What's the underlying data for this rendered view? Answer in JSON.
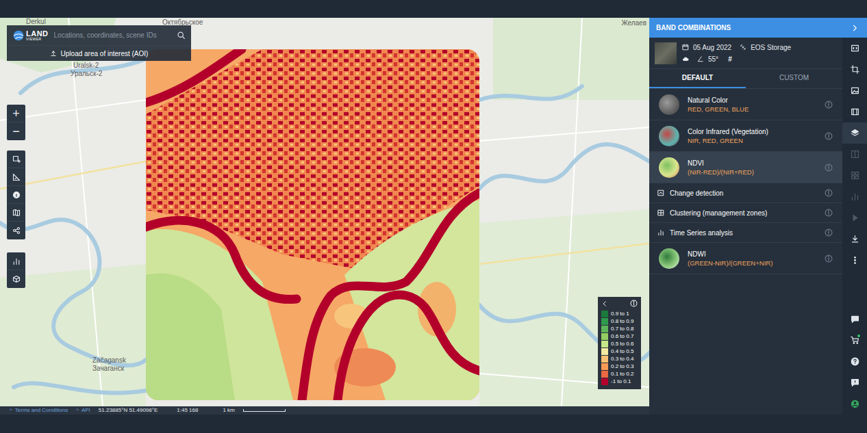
{
  "app": {
    "logo_main": "LAND",
    "logo_sub": "VIEWER"
  },
  "search": {
    "placeholder": "Locations, coordinates, scene IDs"
  },
  "upload_button": {
    "label": "Upload area of interest (AOI)"
  },
  "map_labels": {
    "derkul": "Derkul",
    "oktyabrskoe": "Октябрьское",
    "zhelaev": "Желаев",
    "uralsk_lat": "Uralsk-2",
    "uralsk_cyr": "Уральск-2",
    "zachagansk_lat": "Začagansk",
    "zachagansk_cyr": "Зачаганск"
  },
  "zoom": {
    "in": "+",
    "out": "−"
  },
  "legend": {
    "items": [
      {
        "label": "0.9 to 1",
        "color": "#1b7a3b"
      },
      {
        "label": "0.8 to 0.9",
        "color": "#2f9a4d"
      },
      {
        "label": "0.7 to 0.8",
        "color": "#5db55b"
      },
      {
        "label": "0.6 to 0.7",
        "color": "#93cf63"
      },
      {
        "label": "0.5 to 0.6",
        "color": "#c6e68a"
      },
      {
        "label": "0.4 to 0.5",
        "color": "#f5eaa2"
      },
      {
        "label": "0.3 to 0.4",
        "color": "#fcc072"
      },
      {
        "label": "0.2 to 0.3",
        "color": "#f89a56"
      },
      {
        "label": "0.1 to 0.2",
        "color": "#ea6842"
      },
      {
        "label": "-1 to 0.1",
        "color": "#b3002b"
      }
    ]
  },
  "status_bar": {
    "caret": "^",
    "terms": "Terms and Conditions",
    "api": "API",
    "coordinates": "51.23885°N 51.49098°E",
    "scale_ratio": "1:45 168",
    "scale_label": "1 km"
  },
  "panel": {
    "title": "BAND COMBINATIONS",
    "scene": {
      "date": "05 Aug 2022",
      "storage": "EOS Storage",
      "angle": "55°",
      "grid": "#"
    },
    "tabs": [
      {
        "label": "DEFAULT",
        "selected": true
      },
      {
        "label": "CUSTOM",
        "selected": false
      }
    ],
    "items": [
      {
        "kind": "preset",
        "title": "Natural Color",
        "bands": "RED, GREEN, BLUE",
        "selected": false
      },
      {
        "kind": "preset",
        "title": "Color Infrared (Vegetation)",
        "bands": "NIR, RED, GREEN",
        "selected": false
      },
      {
        "kind": "preset",
        "title": "NDVI",
        "bands": "(NIR-RED)/(NIR+RED)",
        "selected": true
      },
      {
        "kind": "tool",
        "title": "Change detection",
        "selected": false
      },
      {
        "kind": "tool",
        "title": "Clustering (management zones)",
        "selected": false
      },
      {
        "kind": "tool",
        "title": "Time Series analysis",
        "selected": false
      },
      {
        "kind": "preset",
        "title": "NDWI",
        "bands": "(GREEN-NIR)/(GREEN+NIR)",
        "selected": false
      }
    ]
  },
  "rail": {
    "top": [
      {
        "selected": false,
        "disabled": false,
        "notify": false
      },
      {
        "selected": false,
        "disabled": false,
        "notify": false
      },
      {
        "selected": false,
        "disabled": false,
        "notify": false
      },
      {
        "selected": false,
        "disabled": false,
        "notify": false
      },
      {
        "selected": true,
        "disabled": false,
        "notify": false
      },
      {
        "selected": false,
        "disabled": true,
        "notify": false
      },
      {
        "selected": false,
        "disabled": true,
        "notify": false
      },
      {
        "selected": false,
        "disabled": true,
        "notify": false
      },
      {
        "selected": false,
        "disabled": true,
        "notify": false
      },
      {
        "selected": false,
        "disabled": false,
        "notify": false
      },
      {
        "selected": false,
        "disabled": false,
        "notify": false
      }
    ],
    "bottom": [
      {
        "selected": false,
        "disabled": false,
        "notify": false
      },
      {
        "selected": false,
        "disabled": false,
        "notify": true
      },
      {
        "selected": false,
        "disabled": false,
        "notify": false
      },
      {
        "selected": false,
        "disabled": false,
        "notify": false
      },
      {
        "selected": false,
        "disabled": false,
        "notify": false
      }
    ]
  }
}
